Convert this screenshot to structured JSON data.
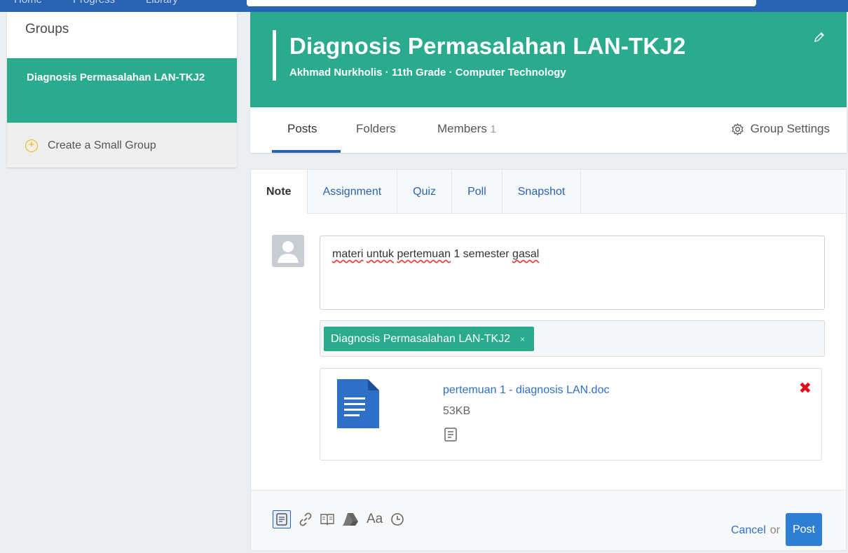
{
  "topnav": {
    "items": [
      "Home",
      "Progress",
      "Library"
    ]
  },
  "sidebar": {
    "title": "Groups",
    "active_group": "Diagnosis Permasalahan LAN-TKJ2",
    "create_label": "Create a Small Group"
  },
  "group": {
    "name": "Diagnosis Permasalahan LAN-TKJ2",
    "subtitle": "Akhmad Nurkholis · 11th Grade · Computer Technology"
  },
  "tabs": {
    "posts": "Posts",
    "folders": "Folders",
    "members": "Members",
    "members_count": "1",
    "settings": "Group Settings"
  },
  "composer": {
    "tabs": [
      "Note",
      "Assignment",
      "Quiz",
      "Poll",
      "Snapshot"
    ],
    "active_tab": "Note",
    "message_words": [
      "materi",
      "untuk",
      "pertemuan",
      "1 semester",
      "gasal"
    ],
    "recipient": "Diagnosis Permasalahan LAN-TKJ2",
    "recipient_remove": "×",
    "attachment": {
      "filename": "pertemuan 1 - diagnosis LAN.doc",
      "size": "53KB",
      "remove": "✖"
    },
    "tools": [
      "note-icon",
      "link-icon",
      "library-icon",
      "drive-icon",
      "text-format-icon",
      "schedule-icon"
    ],
    "tool_text": "Aa",
    "cancel": "Cancel",
    "or": "or",
    "post": "Post"
  },
  "colors": {
    "brand_green": "#2aab8e",
    "brand_blue": "#2863b4",
    "link_blue": "#2e6fc7"
  }
}
